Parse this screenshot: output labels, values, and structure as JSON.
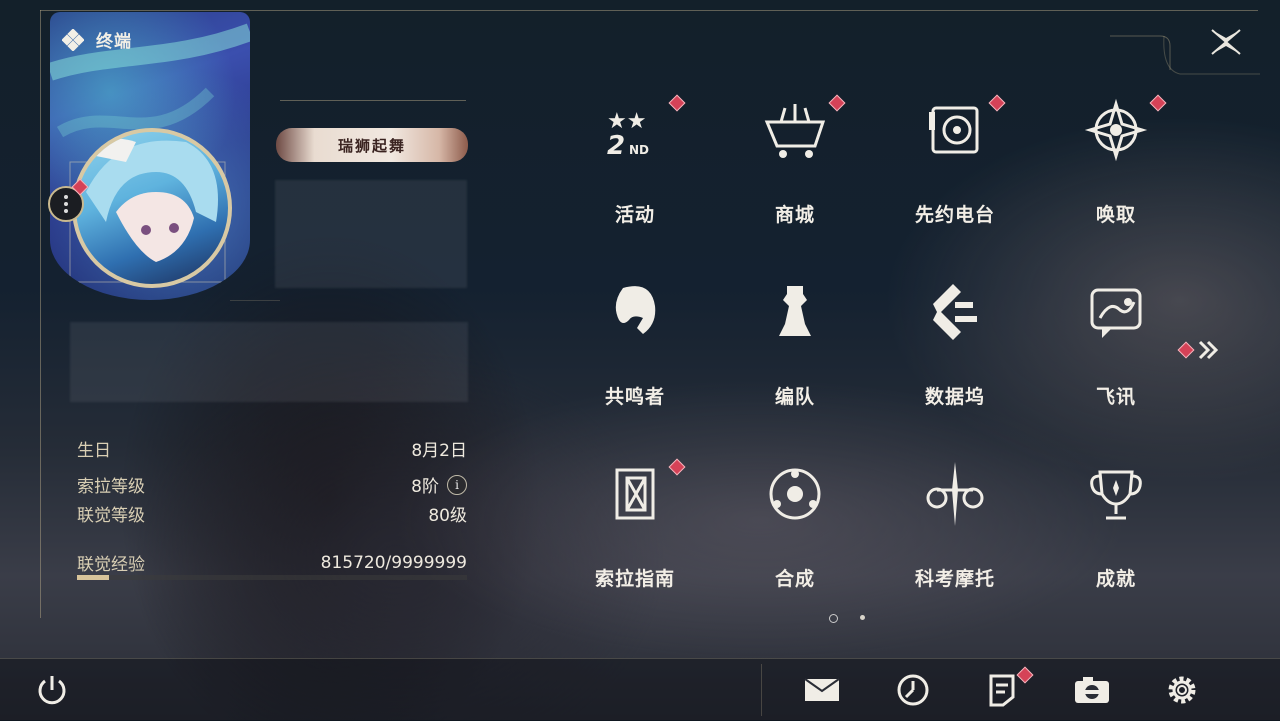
{
  "header": {
    "title": "终端",
    "close_icon": "close-x-icon"
  },
  "profile": {
    "name_plate": "瑞狮起舞",
    "menu_icon": "more-dots-icon"
  },
  "stats": {
    "birthday_label": "生日",
    "birthday_value": "8月2日",
    "sola_level_label": "索拉等级",
    "sola_level_value": "8阶",
    "sola_info_icon": "i",
    "union_level_label": "联觉等级",
    "union_level_value": "80级",
    "union_exp_label": "联觉经验",
    "union_exp_value": "815720/9999999",
    "union_exp_fraction": 0.082
  },
  "grid": {
    "items": [
      {
        "label": "活动",
        "icon": "event-2nd-anniversary-icon",
        "badge": true
      },
      {
        "label": "商城",
        "icon": "shop-cart-icon",
        "badge": true
      },
      {
        "label": "先约电台",
        "icon": "radio-icon",
        "badge": true
      },
      {
        "label": "唤取",
        "icon": "convene-compass-icon",
        "badge": true
      },
      {
        "label": "共鸣者",
        "icon": "resonator-head-icon",
        "badge": false
      },
      {
        "label": "编队",
        "icon": "chess-team-icon",
        "badge": false
      },
      {
        "label": "数据坞",
        "icon": "data-bank-icon",
        "badge": false
      },
      {
        "label": "飞讯",
        "icon": "message-chat-icon",
        "badge": false
      },
      {
        "label": "索拉指南",
        "icon": "guide-book-icon",
        "badge": true
      },
      {
        "label": "合成",
        "icon": "synthesis-icon",
        "badge": false
      },
      {
        "label": "科考摩托",
        "icon": "motorcycle-icon",
        "badge": false
      },
      {
        "label": "成就",
        "icon": "achievement-trophy-icon",
        "badge": false
      }
    ],
    "next_page_icon": "double-chevron-right-icon",
    "page_count": 2,
    "current_page": 1
  },
  "bottom_bar": {
    "power_icon": "power-icon",
    "buttons": [
      "mail-icon",
      "time-clock-icon",
      "notes-icon",
      "camera-icon",
      "settings-gear-icon"
    ]
  },
  "colors": {
    "accent_gold": "#d8c49a",
    "badge_red": "#d54257"
  }
}
